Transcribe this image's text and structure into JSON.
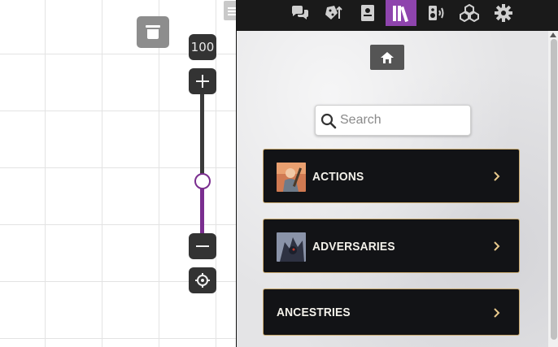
{
  "zoom": {
    "level": "100",
    "slider_value_percent": 40
  },
  "colors": {
    "accent": "#8e44ad",
    "slider": "#7a2e8f",
    "card_border": "#c9a96e",
    "card_bg": "#121316"
  },
  "map_controls": {
    "icons": {
      "layer": "trash-icon",
      "zoom_in": "plus-icon",
      "zoom_out": "minus-icon",
      "recenter": "crosshair-icon",
      "menu": "hamburger-icon"
    }
  },
  "sidebar": {
    "tabs": [
      {
        "icon": "chat-bubbles-icon",
        "active": false
      },
      {
        "icon": "dice-icon",
        "active": false
      },
      {
        "icon": "journal-icon",
        "active": false
      },
      {
        "icon": "compendium-books-icon",
        "active": true
      },
      {
        "icon": "playlist-speaker-icon",
        "active": false
      },
      {
        "icon": "packages-icon",
        "active": false
      },
      {
        "icon": "gear-icon",
        "active": false
      }
    ],
    "home_icon": "home-icon",
    "search": {
      "placeholder": "Search",
      "value": ""
    },
    "categories": [
      {
        "label": "ACTIONS",
        "has_image": true
      },
      {
        "label": "ADVERSARIES",
        "has_image": true
      },
      {
        "label": "ANCESTRIES",
        "has_image": false
      }
    ]
  }
}
